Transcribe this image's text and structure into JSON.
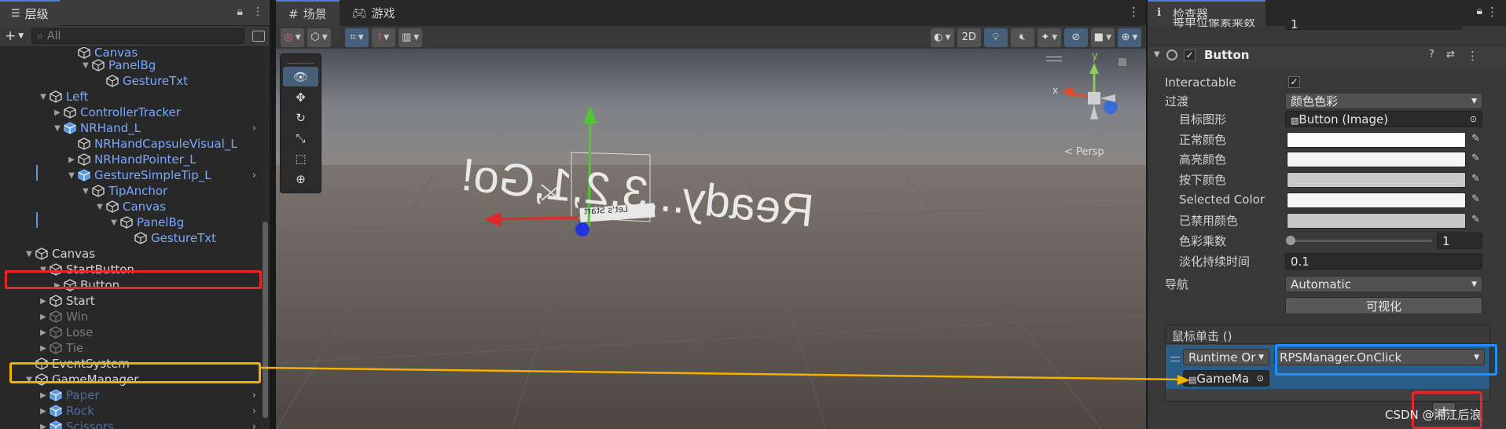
{
  "hierarchy": {
    "title": "层级",
    "add_label": "+",
    "search_placeholder": "All",
    "rows": [
      {
        "label": "Canvas",
        "depth": 6,
        "arrow": "",
        "blue": true
      },
      {
        "label": "PanelBg",
        "depth": 7,
        "arrow": "▼",
        "blue": true
      },
      {
        "label": "GestureTxt",
        "depth": 8,
        "arrow": "",
        "blue": true
      },
      {
        "label": "Left",
        "depth": 4,
        "arrow": "▼",
        "blue": true
      },
      {
        "label": "ControllerTracker",
        "depth": 5,
        "arrow": "▶",
        "blue": true
      },
      {
        "label": "NRHand_L",
        "depth": 5,
        "arrow": "▼",
        "blue": true,
        "prefab": true,
        "chev": true
      },
      {
        "label": "NRHandCapsuleVisual_L",
        "depth": 6,
        "arrow": "",
        "blue": true
      },
      {
        "label": "NRHandPointer_L",
        "depth": 6,
        "arrow": "▶",
        "blue": true
      },
      {
        "label": "GestureSimpleTip_L",
        "depth": 6,
        "arrow": "▼",
        "blue": true,
        "prefab": true,
        "chev": true
      },
      {
        "label": "TipAnchor",
        "depth": 7,
        "arrow": "▼",
        "blue": true
      },
      {
        "label": "Canvas",
        "depth": 8,
        "arrow": "▼",
        "blue": true
      },
      {
        "label": "PanelBg",
        "depth": 9,
        "arrow": "▼",
        "blue": true
      },
      {
        "label": "GestureTxt",
        "depth": 10,
        "arrow": "",
        "blue": true
      },
      {
        "label": "Canvas",
        "depth": 3,
        "arrow": "▼"
      },
      {
        "label": "StartButton",
        "depth": 4,
        "arrow": "▼"
      },
      {
        "label": "Button",
        "depth": 5,
        "arrow": "▶"
      },
      {
        "label": "Start",
        "depth": 4,
        "arrow": "▶"
      },
      {
        "label": "Win",
        "depth": 4,
        "arrow": "▶",
        "dim": true
      },
      {
        "label": "Lose",
        "depth": 4,
        "arrow": "▶",
        "dim": true
      },
      {
        "label": "Tie",
        "depth": 4,
        "arrow": "▶",
        "dim": true
      },
      {
        "label": "EventSystem",
        "depth": 3,
        "arrow": ""
      },
      {
        "label": "GameManager",
        "depth": 3,
        "arrow": "▼"
      },
      {
        "label": "Paper",
        "depth": 4,
        "arrow": "▶",
        "dimb": true,
        "prefab": true,
        "chev": true
      },
      {
        "label": "Rock",
        "depth": 4,
        "arrow": "▶",
        "dimb": true,
        "prefab": true,
        "chev": true
      },
      {
        "label": "Scissors",
        "depth": 4,
        "arrow": "▶",
        "dimb": true,
        "prefab": true,
        "chev": true
      }
    ]
  },
  "scene": {
    "tab_scene": "场景",
    "tab_game": "游戏",
    "btn_2d": "2D",
    "world_text": "Ready...3,2,1,Go!",
    "ui_text": "Let's Start",
    "persp_label": "< Persp",
    "axis_x": "x",
    "axis_y": "y"
  },
  "inspector": {
    "title": "检查器",
    "top_field_label": "每单位像素乘数",
    "top_field_value": "1",
    "component": "Button",
    "rows": [
      {
        "label": "Interactable",
        "kind": "check"
      },
      {
        "label": "过渡",
        "kind": "drop",
        "value": "颜色色彩"
      },
      {
        "label": "目标图形",
        "kind": "ref",
        "value": "Button (Image)"
      },
      {
        "label": "正常颜色",
        "kind": "color",
        "value": "#ffffff"
      },
      {
        "label": "高亮颜色",
        "kind": "color",
        "value": "#f5f5f5"
      },
      {
        "label": "按下颜色",
        "kind": "color",
        "value": "#c8c8c8"
      },
      {
        "label": "Selected Color",
        "kind": "color",
        "value": "#f5f5f5"
      },
      {
        "label": "已禁用颜色",
        "kind": "color",
        "value": "#c8c8c8"
      },
      {
        "label": "色彩乘数",
        "kind": "slider",
        "value": "1"
      },
      {
        "label": "淡化持续时间",
        "kind": "text",
        "value": "0.1"
      }
    ],
    "nav_label": "导航",
    "nav_value": "Automatic",
    "visualize_label": "可视化",
    "event_title": "鼠标单击 ()",
    "runtime_value": "Runtime Or",
    "function_value": "RPSManager.OnClick",
    "object_value": "GameMa",
    "add_btn": "+"
  },
  "watermark": "CSDN @湘江后浪",
  "colors": {
    "accent": "#4c7fd6",
    "red": "#e8262b",
    "orange": "#f4b100",
    "blue_box": "#1e90ff"
  }
}
